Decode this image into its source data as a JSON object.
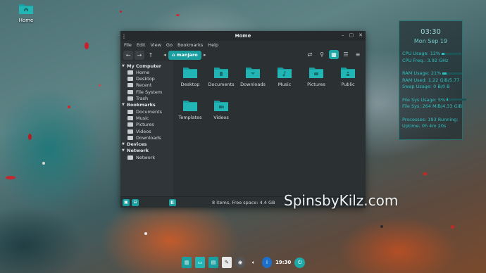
{
  "desktop": {
    "home_icon_label": "Home",
    "watermark": "SpinsbyKilz.com"
  },
  "window": {
    "title": "Home",
    "menu": [
      "File",
      "Edit",
      "View",
      "Go",
      "Bookmarks",
      "Help"
    ],
    "location": "manjaro",
    "sidebar": {
      "sections": [
        {
          "label": "My Computer",
          "items": [
            "Home",
            "Desktop",
            "Recent",
            "File System",
            "Trash"
          ]
        },
        {
          "label": "Bookmarks",
          "items": [
            "Documents",
            "Music",
            "Pictures",
            "Videos",
            "Downloads"
          ]
        },
        {
          "label": "Devices",
          "items": []
        },
        {
          "label": "Network",
          "items": [
            "Network"
          ]
        }
      ]
    },
    "files": [
      "Desktop",
      "Documents",
      "Downloads",
      "Music",
      "Pictures",
      "Public",
      "Templates",
      "Videos"
    ],
    "status": "8 items, Free space: 4.4 GB"
  },
  "conky": {
    "time": "03:30",
    "date": "Mon Sep 19",
    "cpu_usage": "CPU Usage: 12%",
    "cpu_usage_level": 0.12,
    "cpu_freq": "CPU Freq.: 3.92 GHz",
    "ram_usage": "RAM Usage: 21%",
    "ram_usage_level": 0.21,
    "ram_used": "RAM Used: 1.22 GiB/5.77",
    "swap": "Swap Usage: 0 B/0 B",
    "fs_usage": "File Sys Usage: 5%",
    "fs_usage_level": 0.05,
    "fs_size": "File Sys: 264 MiB/4.33 GiB",
    "processes": "Processes: 193   Running:",
    "uptime": "Uptime: 0h 4m 20s"
  },
  "dock": {
    "time": "19:30"
  },
  "colors": {
    "accent": "#1fa8a8",
    "window_bg": "#2b3033",
    "sidebar_bg": "#2f3538"
  }
}
